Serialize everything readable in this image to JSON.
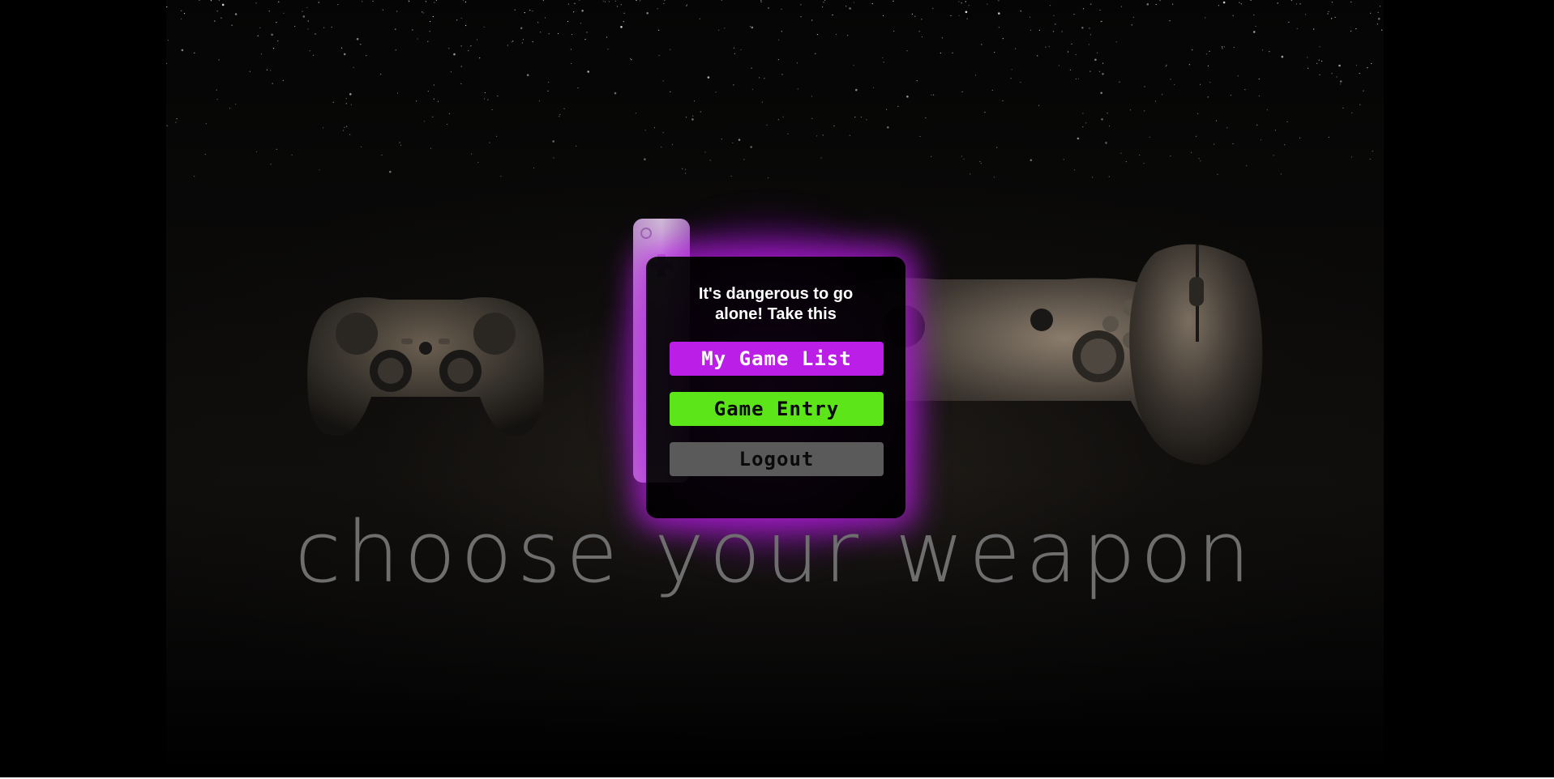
{
  "background": {
    "devices": [
      "playstation-controller",
      "wii-remote",
      "xbox-controller",
      "computer-mouse"
    ]
  },
  "menu": {
    "heading": "It's dangerous to go alone! Take this",
    "buttons": {
      "game_list": "My Game List",
      "game_entry": "Game Entry",
      "logout": "Logout"
    }
  },
  "tagline": "choose your weapon",
  "colors": {
    "glow": "#bb1ee6",
    "game_list_button": "#bb1ee6",
    "game_entry_button": "#5ce61a",
    "logout_button": "#5a5a5a"
  }
}
